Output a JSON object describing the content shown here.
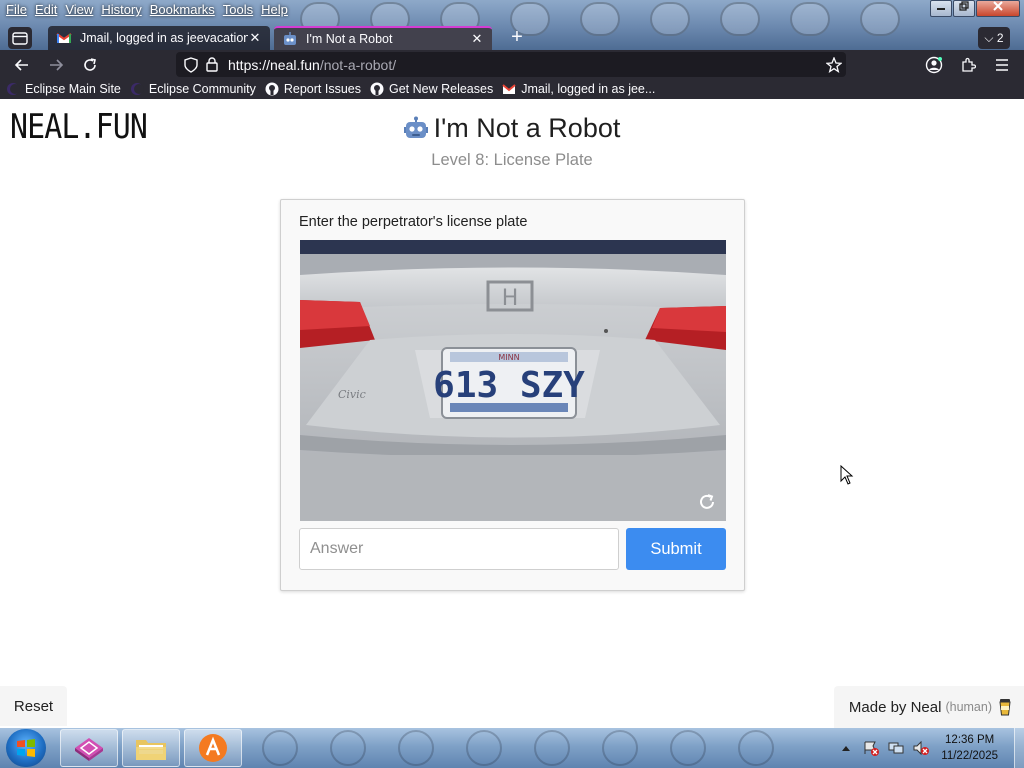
{
  "browser": {
    "menu": [
      "File",
      "Edit",
      "View",
      "History",
      "Bookmarks",
      "Tools",
      "Help"
    ],
    "tabs": [
      {
        "title": "Jmail, logged in as jeevacation@",
        "icon": "gmail-icon",
        "active": false
      },
      {
        "title": "I'm Not a Robot",
        "icon": "robot-icon",
        "active": true
      }
    ],
    "tab_count": "2",
    "url_host": "https://neal.fun",
    "url_path": "/not-a-robot/",
    "bookmarks": [
      {
        "label": "Eclipse Main Site",
        "icon": "eclipse-icon"
      },
      {
        "label": "Eclipse Community",
        "icon": "eclipse-icon"
      },
      {
        "label": "Report Issues",
        "icon": "github-icon"
      },
      {
        "label": "Get New Releases",
        "icon": "github-icon"
      },
      {
        "label": "Jmail, logged in as jee...",
        "icon": "gmail-icon"
      }
    ]
  },
  "page": {
    "logo": "NEAL.FUN",
    "title": "I'm Not a Robot",
    "level": "Level 8: License Plate",
    "prompt": "Enter the perpetrator's license plate",
    "plate_text": "613 SZY",
    "answer_placeholder": "Answer",
    "submit_label": "Submit",
    "reset_label": "Reset",
    "made_by": "Made by Neal",
    "human": "(human)"
  },
  "taskbar": {
    "time": "12:36 PM",
    "date": "11/22/2025"
  },
  "colors": {
    "accent": "#3c8cf0",
    "active_tab_indicator": "#d43dd4"
  }
}
